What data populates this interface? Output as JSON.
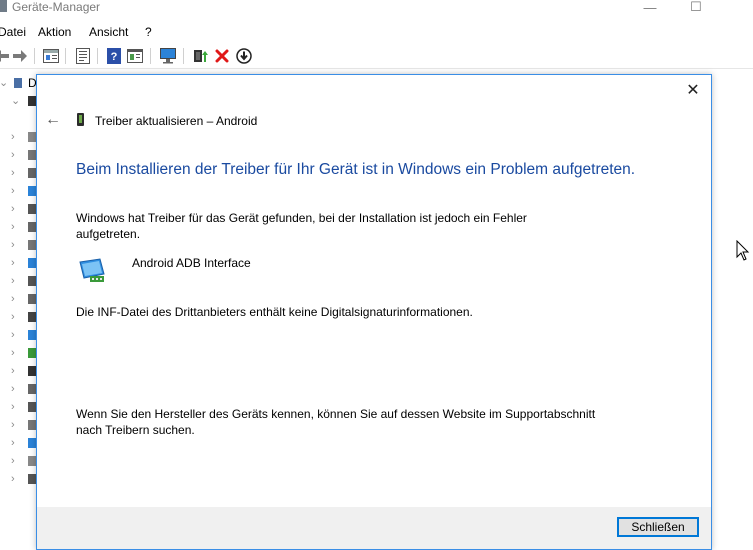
{
  "window": {
    "title": "Geräte-Manager",
    "controls": {
      "minimize": "—",
      "maximize": "☐"
    }
  },
  "menu": [
    "Datei",
    "Aktion",
    "Ansicht",
    "?"
  ],
  "toolbar": {
    "icons": [
      "back-icon",
      "forward-icon",
      "properties-icon",
      "driver-icon",
      "help-icon",
      "view-icon",
      "monitor-scan-icon",
      "update-driver-icon",
      "uninstall-icon",
      "disable-icon"
    ]
  },
  "tree": {
    "root_label": "D",
    "rows": 22
  },
  "dialog": {
    "close_glyph": "✕",
    "back_glyph": "←",
    "header_title": "Treiber aktualisieren – Android",
    "headline": "Beim Installieren der Treiber für Ihr Gerät ist in Windows ein Problem aufgetreten.",
    "paragraph1": "Windows hat Treiber für das Gerät gefunden, bei der Installation ist jedoch ein Fehler aufgetreten.",
    "device_name": "Android ADB Interface",
    "error_detail": "Die INF-Datei des Drittanbieters enthält keine Digitalsignaturinformationen.",
    "paragraph3": "Wenn Sie den Hersteller des Geräts kennen, können Sie auf dessen Website im Supportabschnitt nach Treibern suchen.",
    "close_button": "Schließen"
  },
  "colors": {
    "accent": "#0078d7",
    "headline": "#1a4aa0",
    "footer": "#f0f0f0"
  }
}
